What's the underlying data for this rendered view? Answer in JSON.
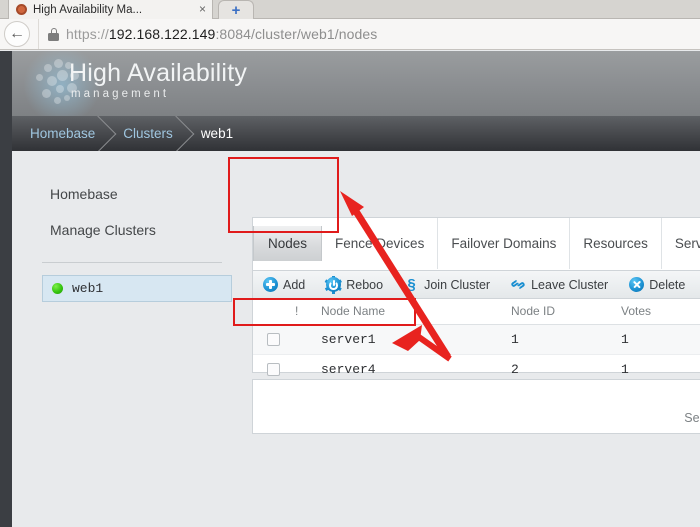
{
  "browser": {
    "tab": {
      "title": "High Availability Ma...",
      "favicon": "app-favicon",
      "close": "×"
    },
    "newtab_label": "+",
    "back_label": "←",
    "url": {
      "scheme": "https://",
      "host": "192.168.122.149",
      "path": ":8084/cluster/web1/nodes",
      "full": "https://192.168.122.149:8084/cluster/web1/nodes"
    }
  },
  "app": {
    "logo_title": "High Availability",
    "logo_subtitle": "management",
    "breadcrumb": [
      {
        "label": "Homebase",
        "current": false
      },
      {
        "label": "Clusters",
        "current": false
      },
      {
        "label": "web1",
        "current": true
      }
    ]
  },
  "sidebar": {
    "links": [
      {
        "label": "Homebase"
      },
      {
        "label": "Manage Clusters"
      }
    ],
    "clusters": [
      {
        "name": "web1",
        "status": "online",
        "status_color": "#36c510"
      }
    ]
  },
  "main": {
    "tabs": [
      {
        "label": "Nodes",
        "active": true
      },
      {
        "label": "Fence Devices",
        "active": false
      },
      {
        "label": "Failover Domains",
        "active": false
      },
      {
        "label": "Resources",
        "active": false
      },
      {
        "label": "Service Grou",
        "active": false
      }
    ],
    "toolbar": [
      {
        "label": "Add",
        "icon": "add-circle-icon"
      },
      {
        "label": "Reboo",
        "icon": "reboot-gear-icon"
      },
      {
        "label": "Join Cluster",
        "icon": "link-icon"
      },
      {
        "label": "Leave Cluster",
        "icon": "unlink-icon"
      },
      {
        "label": "Delete",
        "icon": "delete-circle-icon"
      }
    ],
    "table": {
      "columns": [
        "",
        "!",
        "Node Name",
        "Node ID",
        "Votes"
      ],
      "rows": [
        {
          "checked": false,
          "bang": "",
          "name": "server1",
          "node_id": "1",
          "votes": "1"
        },
        {
          "checked": false,
          "bang": "",
          "name": "server4",
          "node_id": "2",
          "votes": "1"
        }
      ]
    },
    "footer_text": "Select  "
  },
  "annotations": {
    "accent_color": "#e01b1b",
    "boxes": [
      {
        "name": "nodes-tab-highlight"
      },
      {
        "name": "server1-row-highlight"
      }
    ],
    "arrow": {
      "name": "double-headed-arrow"
    }
  }
}
